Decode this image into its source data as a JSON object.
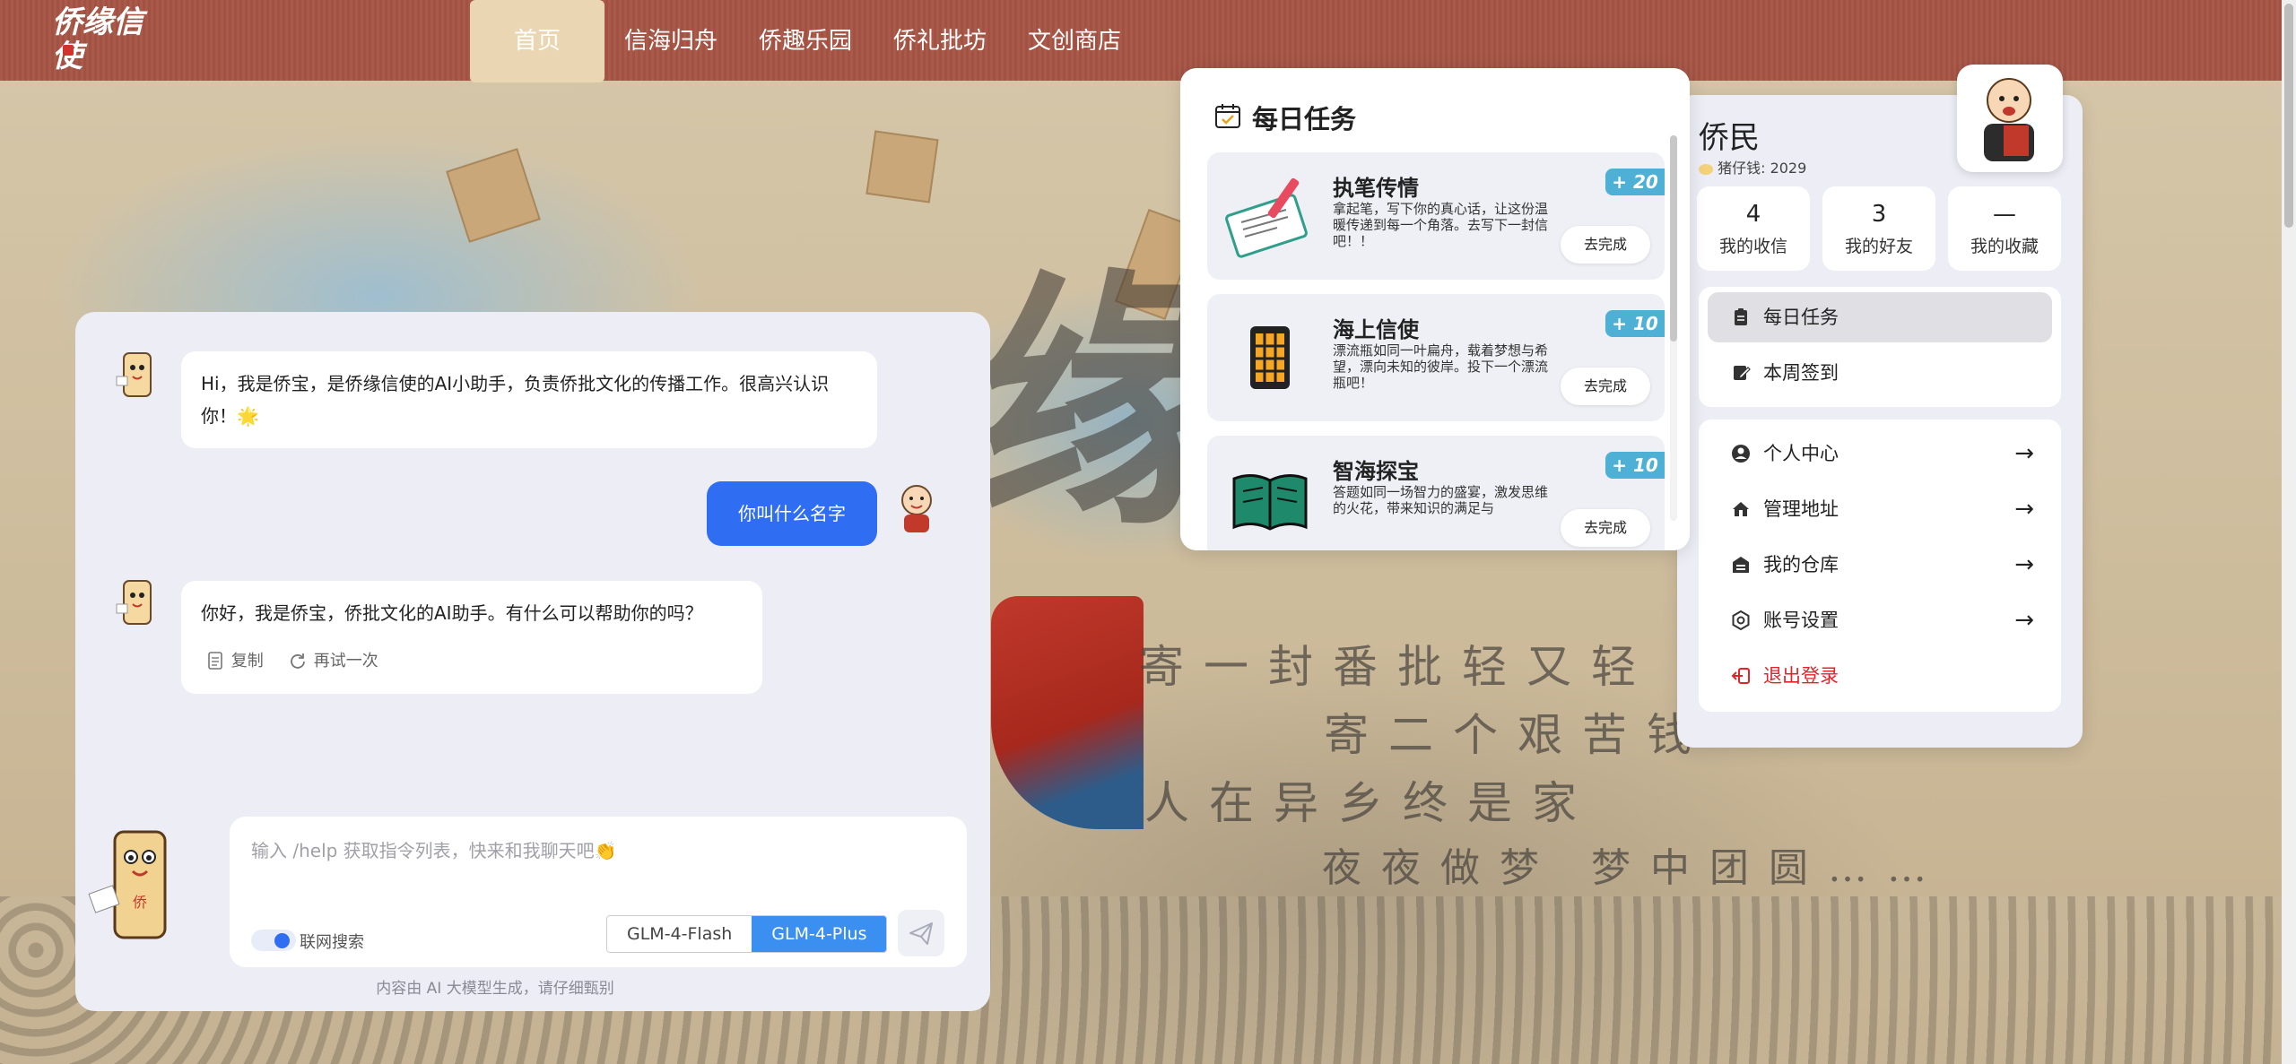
{
  "app": {
    "logo_text": "侨缘信使"
  },
  "nav": {
    "items": [
      "首页",
      "信海归舟",
      "侨趣乐园",
      "侨礼批坊",
      "文创商店"
    ],
    "active_index": 0
  },
  "background": {
    "poem_lines": [
      "寄一封番批轻又轻",
      "寄二个艰苦钱",
      "人在异乡终是家",
      "夜夜做梦 梦中团圆……"
    ]
  },
  "chat": {
    "messages": [
      {
        "role": "bot",
        "text": "Hi，我是侨宝，是侨缘信使的AI小助手，负责侨批文化的传播工作。很高兴认识你！🌟"
      },
      {
        "role": "user",
        "text": "你叫什么名字"
      },
      {
        "role": "bot",
        "text": "你好，我是侨宝，侨批文化的AI助手。有什么可以帮助你的吗？"
      }
    ],
    "actions": {
      "copy": "复制",
      "retry": "再试一次"
    },
    "input": {
      "placeholder": "输入 /help 获取指令列表，快来和我聊天吧👏",
      "web_search_label": "联网搜索",
      "web_search_on": true,
      "models": [
        "GLM-4-Flash",
        "GLM-4-Plus"
      ],
      "selected_model": "GLM-4-Plus"
    },
    "disclaimer": "内容由 AI 大模型生成，请仔细甄别"
  },
  "daily_tasks": {
    "title": "每日任务",
    "items": [
      {
        "name": "执笔传情",
        "desc": "拿起笔，写下你的真心话，让这份温暖传递到每一个角落。去写下一封信吧！！",
        "points": "+ 20",
        "button": "去完成",
        "icon": "pen-letter-icon"
      },
      {
        "name": "海上信使",
        "desc": "漂流瓶如同一叶扁舟，载着梦想与希望，漂向未知的彼岸。投下一个漂流瓶吧！",
        "points": "+ 10",
        "button": "去完成",
        "icon": "bottle-icon"
      },
      {
        "name": "智海探宝",
        "desc": "答题如同一场智力的盛宴，激发思维的火花，带来知识的满足与",
        "points": "+ 10",
        "button": "去完成",
        "icon": "book-icon"
      }
    ]
  },
  "user": {
    "name": "侨民",
    "coins_label": "猪仔钱: 2029",
    "stats": [
      {
        "num": "4",
        "label": "我的收信"
      },
      {
        "num": "3",
        "label": "我的好友"
      },
      {
        "num": "—",
        "label": "我的收藏"
      }
    ],
    "quick_menu": [
      {
        "label": "每日任务",
        "icon": "clipboard-icon",
        "active": true
      },
      {
        "label": "本周签到",
        "icon": "edit-note-icon",
        "active": false
      }
    ],
    "menu": [
      {
        "label": "个人中心",
        "icon": "user-circle-icon"
      },
      {
        "label": "管理地址",
        "icon": "home-icon"
      },
      {
        "label": "我的仓库",
        "icon": "warehouse-icon"
      },
      {
        "label": "账号设置",
        "icon": "settings-icon"
      }
    ],
    "logout": "退出登录",
    "arrow": "→"
  },
  "colors": {
    "nav_bg": "#a65545",
    "accent_blue": "#2f6ef2",
    "points_badge": "#4fb0d6",
    "logout_red": "#e0242b"
  }
}
